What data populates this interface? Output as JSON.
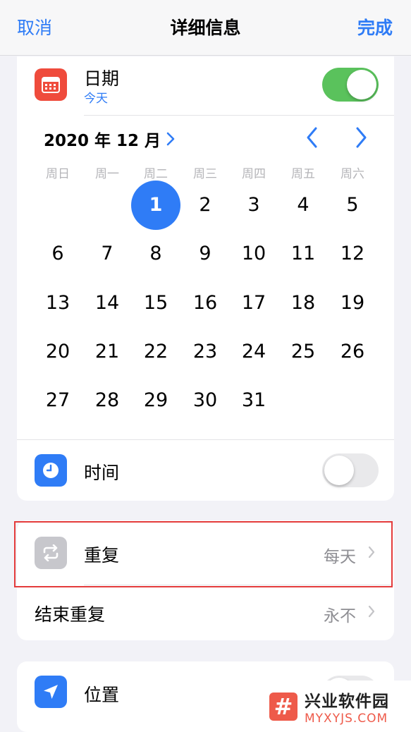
{
  "nav": {
    "cancel": "取消",
    "title": "详细信息",
    "done": "完成"
  },
  "date_row": {
    "label": "日期",
    "sub": "今天",
    "toggle_on": true,
    "icon": "calendar-icon"
  },
  "calendar": {
    "month_label": "2020 年 12 月",
    "weekdays": [
      "周日",
      "周一",
      "周二",
      "周三",
      "周四",
      "周五",
      "周六"
    ],
    "first_weekday_index": 2,
    "days_in_month": 31,
    "selected_day": 1
  },
  "time_row": {
    "label": "时间",
    "toggle_on": false,
    "icon": "clock-icon"
  },
  "repeat_row": {
    "label": "重复",
    "value": "每天",
    "icon": "repeat-icon"
  },
  "end_repeat_row": {
    "label": "结束重复",
    "value": "永不"
  },
  "location_row": {
    "label": "位置",
    "icon": "location-arrow-icon"
  },
  "colors": {
    "accent": "#2f7cf6",
    "toggle_on": "#5ac25c",
    "calendar_icon": "#ef4b3c",
    "highlight": "#e43b3b"
  },
  "watermark": {
    "title": "兴业软件园",
    "url": "MYXYJS.COM",
    "logo": "#"
  }
}
